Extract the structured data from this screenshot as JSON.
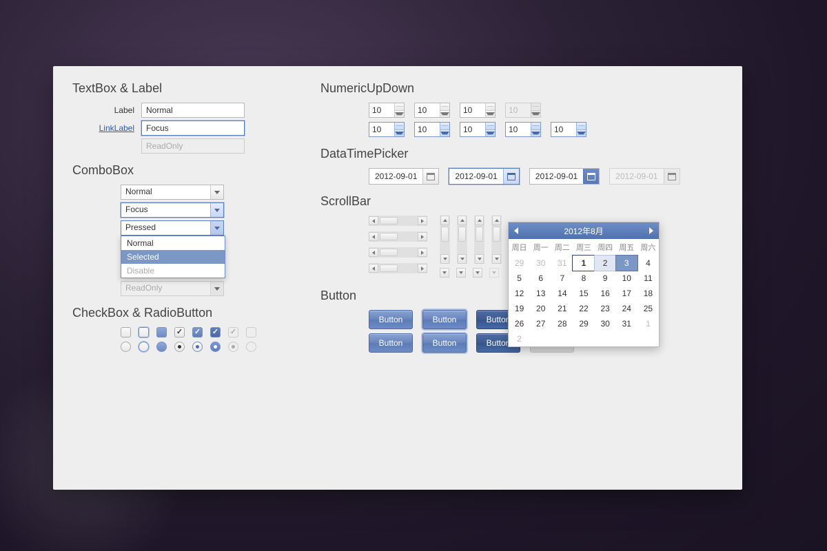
{
  "sections": {
    "textbox": "TextBox & Label",
    "combobox": "ComboBox",
    "checkbox": "CheckBox & RadioButton",
    "numeric": "NumericUpDown",
    "datetime": "DataTimePicker",
    "scrollbar": "ScrollBar",
    "button": "Button"
  },
  "textbox": {
    "label": "Label",
    "linklabel": "LinkLabel",
    "normal": "Normal",
    "focus": "Focus",
    "readonly": "ReadOnly"
  },
  "combo": {
    "normal": "Normal",
    "focus": "Focus",
    "pressed": "Pressed",
    "readonly": "ReadOnly",
    "opts": {
      "normal": "Normal",
      "selected": "Selected",
      "disable": "Disable"
    }
  },
  "numeric": {
    "val": "10"
  },
  "datetime": {
    "val": "2012-09-01"
  },
  "calendar": {
    "title": "2012年8月",
    "dow": [
      "周日",
      "周一",
      "周二",
      "周三",
      "周四",
      "周五",
      "周六"
    ],
    "rows": [
      [
        "29",
        "30",
        "31",
        "1",
        "2",
        "3",
        "4"
      ],
      [
        "5",
        "6",
        "7",
        "8",
        "9",
        "10",
        "11"
      ],
      [
        "12",
        "13",
        "14",
        "15",
        "16",
        "17",
        "18"
      ],
      [
        "19",
        "20",
        "21",
        "22",
        "23",
        "24",
        "25"
      ],
      [
        "26",
        "27",
        "28",
        "29",
        "30",
        "31",
        "1",
        "2"
      ]
    ]
  },
  "button": {
    "label": "Button"
  }
}
